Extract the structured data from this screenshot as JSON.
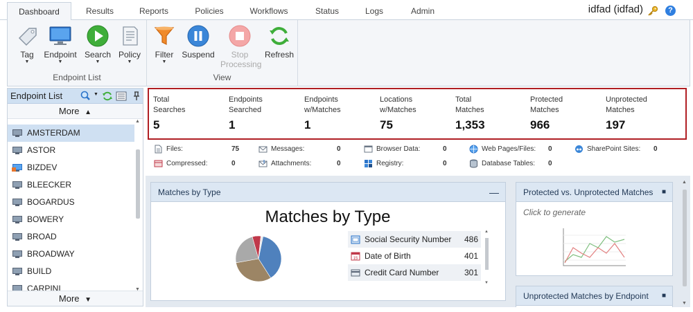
{
  "tabs": [
    "Dashboard",
    "Results",
    "Reports",
    "Policies",
    "Workflows",
    "Status",
    "Logs",
    "Admin"
  ],
  "user": "idfad (idfad)",
  "ribbon": {
    "endpoint_list": {
      "label": "Endpoint List",
      "buttons": [
        "Tag",
        "Endpoint",
        "Search",
        "Policy"
      ]
    },
    "view": {
      "label": "View",
      "buttons": [
        "Filter",
        "Suspend",
        "Stop Processing",
        "Refresh"
      ]
    }
  },
  "endpoint_panel": {
    "title": "Endpoint List",
    "more_label": "More",
    "items": [
      "AMSTERDAM",
      "ASTOR",
      "BIZDEV",
      "BLEECKER",
      "BOGARDUS",
      "BOWERY",
      "BROAD",
      "BROADWAY",
      "BUILD",
      "CARPINI"
    ]
  },
  "stats": [
    {
      "label": "Total\nSearches",
      "value": "5"
    },
    {
      "label": "Endpoints\nSearched",
      "value": "1"
    },
    {
      "label": "Endpoints\nw/Matches",
      "value": "1"
    },
    {
      "label": "Locations\nw/Matches",
      "value": "75"
    },
    {
      "label": "Total\nMatches",
      "value": "1,353"
    },
    {
      "label": "Protected\nMatches",
      "value": "966"
    },
    {
      "label": "Unprotected\nMatches",
      "value": "197"
    }
  ],
  "sub_stats": [
    {
      "label": "Files:",
      "value": "75"
    },
    {
      "label": "Compressed:",
      "value": "0"
    },
    {
      "label": "Messages:",
      "value": "0"
    },
    {
      "label": "Attachments:",
      "value": "0"
    },
    {
      "label": "Browser Data:",
      "value": "0"
    },
    {
      "label": "Registry:",
      "value": "0"
    },
    {
      "label": "Web Pages/Files:",
      "value": "0"
    },
    {
      "label": "Database Tables:",
      "value": "0"
    },
    {
      "label": "SharePoint Sites:",
      "value": "0"
    }
  ],
  "matches_panel": {
    "header": "Matches by Type",
    "title": "Matches by Type"
  },
  "protected_panel": {
    "header": "Protected vs. Unprotected Matches",
    "hint": "Click to generate"
  },
  "unprotected_panel": {
    "header": "Unprotected Matches by Endpoint"
  },
  "chart_data": {
    "type": "pie",
    "title": "Matches by Type",
    "categories": [
      "Social Security Number",
      "Date of Birth",
      "Credit Card Number"
    ],
    "values": [
      486,
      401,
      301
    ],
    "colors": [
      "#4f81bd",
      "#9c8565",
      "#a9a9a9"
    ],
    "extra_slices_colors": [
      "#c0394a",
      "#e9e9e9"
    ]
  }
}
